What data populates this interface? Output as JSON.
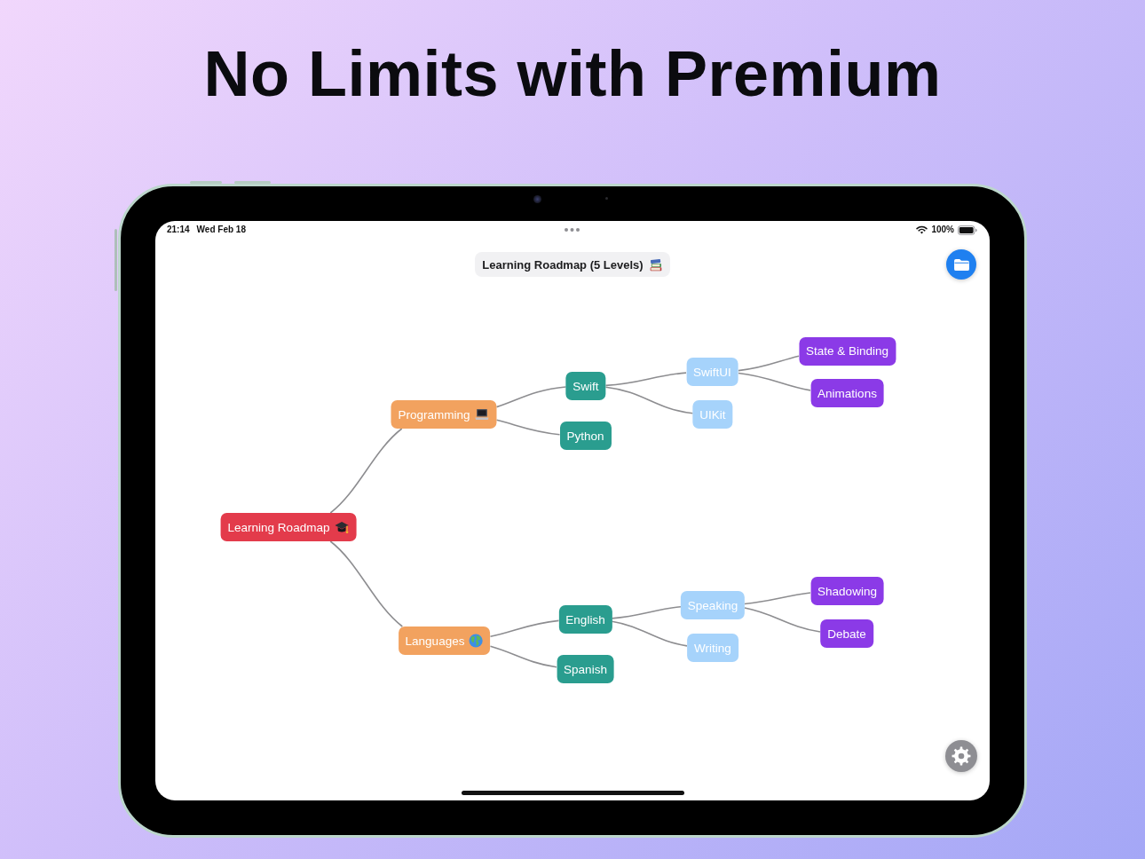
{
  "headline": "No Limits with Premium",
  "status_bar": {
    "time": "21:14",
    "date": "Wed Feb 18",
    "battery": "100%"
  },
  "map_title": "Learning Roadmap (5 Levels)",
  "mind_map": {
    "root": {
      "label": "Learning Roadmap",
      "color": "#e33b4b",
      "children": [
        {
          "label": "Programming",
          "color": "#f2a25f",
          "children": [
            {
              "label": "Swift",
              "color": "#2a9d8f",
              "children": [
                {
                  "label": "SwiftUI",
                  "color": "#a6d3fb",
                  "children": [
                    {
                      "label": "State & Binding",
                      "color": "#8b3ae7"
                    },
                    {
                      "label": "Animations",
                      "color": "#8b3ae7"
                    }
                  ]
                },
                {
                  "label": "UIKit",
                  "color": "#a6d3fb"
                }
              ]
            },
            {
              "label": "Python",
              "color": "#2a9d8f"
            }
          ]
        },
        {
          "label": "Languages",
          "color": "#f2a25f",
          "children": [
            {
              "label": "English",
              "color": "#2a9d8f",
              "children": [
                {
                  "label": "Speaking",
                  "color": "#a6d3fb",
                  "children": [
                    {
                      "label": "Shadowing",
                      "color": "#8b3ae7"
                    },
                    {
                      "label": "Debate",
                      "color": "#8b3ae7"
                    }
                  ]
                },
                {
                  "label": "Writing",
                  "color": "#a6d3fb"
                }
              ]
            },
            {
              "label": "Spanish",
              "color": "#2a9d8f"
            }
          ]
        }
      ]
    }
  }
}
